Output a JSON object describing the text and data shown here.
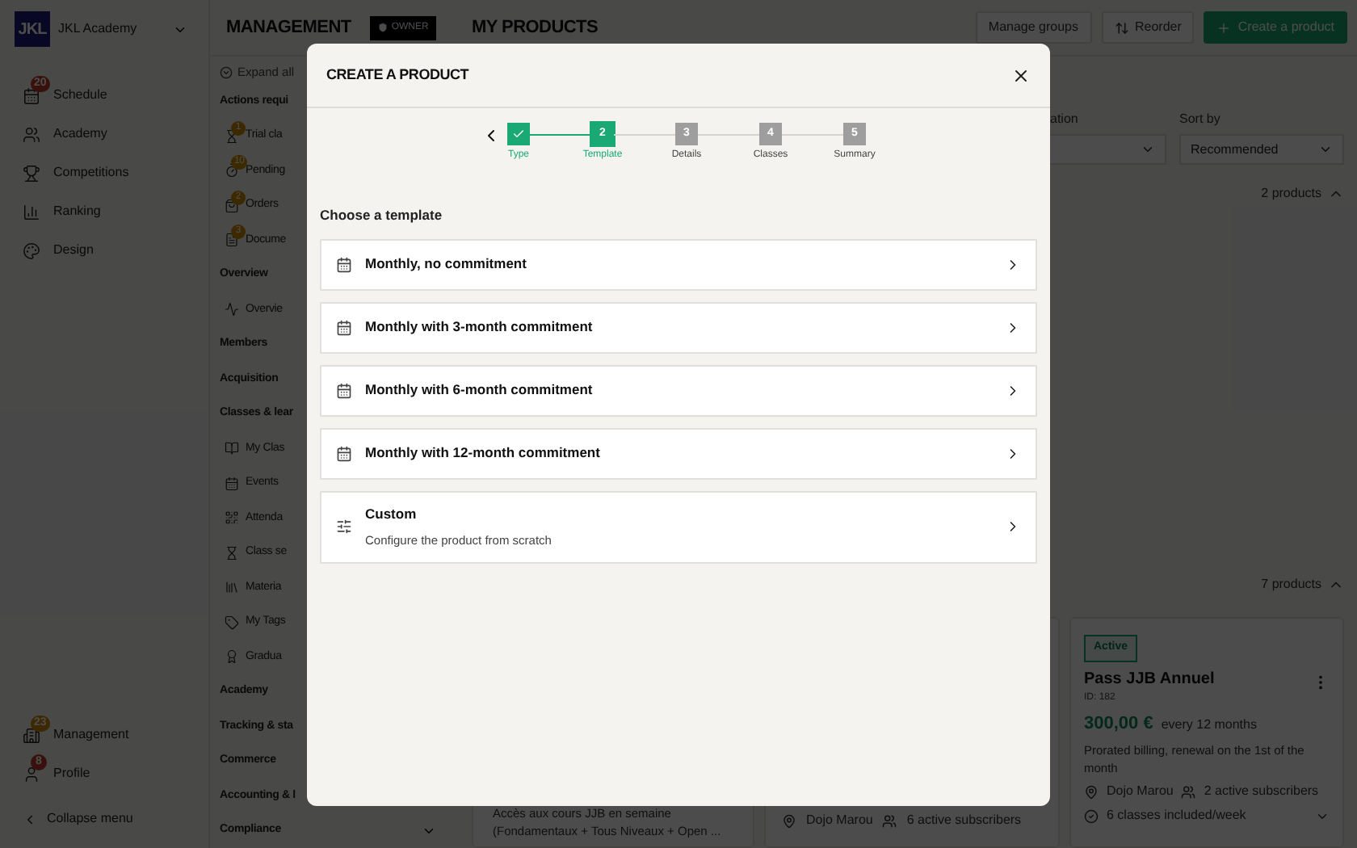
{
  "sidebar": {
    "academy_name": "JKL Academy",
    "logo_text": "JKL",
    "items": [
      {
        "label": "Schedule",
        "kind": "calendar",
        "badge": {
          "count": "20",
          "kind": "alert"
        }
      },
      {
        "label": "Academy",
        "kind": "users"
      },
      {
        "label": "Competitions",
        "kind": "trophy"
      },
      {
        "label": "Ranking",
        "kind": "ranking"
      },
      {
        "label": "Design",
        "kind": "palette"
      }
    ],
    "bottom_items": [
      {
        "label": "Management",
        "kind": "building",
        "badge": {
          "count": "23",
          "kind": "warning"
        }
      },
      {
        "label": "Profile",
        "kind": "user",
        "badge": {
          "count": "8",
          "kind": "alert"
        }
      }
    ],
    "collapse": "Collapse menu"
  },
  "header": {
    "section_title": "MANAGEMENT",
    "role_badge": "OWNER",
    "page_title": "MY PRODUCTS",
    "buttons": [
      {
        "label": "Manage groups",
        "kind": "plain"
      },
      {
        "label": "Reorder",
        "kind": "reorder"
      },
      {
        "label": "Create a product",
        "kind": "primary"
      }
    ]
  },
  "management_nav": {
    "expand_all": "Expand all",
    "sections": [
      {
        "label": "Actions requi",
        "children": [
          {
            "label": "Trial cla",
            "kind": "hourglass",
            "badge": "1"
          },
          {
            "label": "Pending",
            "kind": "timer",
            "badge": "10"
          },
          {
            "label": "Orders",
            "kind": "bag",
            "badge": "2"
          },
          {
            "label": "Docume",
            "kind": "document",
            "badge": "3"
          }
        ]
      },
      {
        "label": "Overview",
        "children": [
          {
            "label": "Overvie",
            "kind": "pulse"
          }
        ]
      },
      {
        "label": "Members"
      },
      {
        "label": "Acquisition"
      },
      {
        "label": "Classes & lear",
        "children": [
          {
            "label": "My Clas",
            "kind": "book"
          },
          {
            "label": "Events",
            "kind": "calendar"
          },
          {
            "label": "Attenda",
            "kind": "qr"
          },
          {
            "label": "Class se",
            "kind": "hourglass"
          },
          {
            "label": "Materia",
            "kind": "library"
          },
          {
            "label": "My Tags",
            "kind": "tag"
          },
          {
            "label": "Gradua",
            "kind": "award"
          }
        ]
      },
      {
        "label": "Academy"
      },
      {
        "label": "Tracking & sta"
      },
      {
        "label": "Commerce"
      },
      {
        "label": "Accounting & l"
      },
      {
        "label": "Compliance",
        "expanded": false
      }
    ]
  },
  "filters": [
    {
      "label": "ation"
    },
    {
      "label": "Sort by",
      "value": "Recommended"
    }
  ],
  "groups": [
    {
      "count": "2 products",
      "expanded": true
    },
    {
      "count": "7 products",
      "expanded": true
    }
  ],
  "cards": [
    {
      "kind": "text",
      "description": "Accès aux cours JJB en semaine (Fondamentaux + Tous Niveaux + Open ..."
    },
    {
      "kind": "meta",
      "location": "Dojo Marou",
      "subscribers": "6 active subscribers"
    },
    {
      "kind": "full",
      "status": "Active",
      "name": "Pass JJB Annuel",
      "id": "ID: 182",
      "price": "300,00 €",
      "period": "every 12 months",
      "billing": "Prorated billing, renewal on the 1st of the month",
      "location": "Dojo Marou",
      "subscribers": "2 active subscribers",
      "classes": "6 classes included/week"
    }
  ],
  "dialog": {
    "title": "CREATE A PRODUCT",
    "steps": [
      {
        "label": "Type",
        "completed": true,
        "selected": false
      },
      {
        "number": "2",
        "label": "Template",
        "completed": false,
        "selected": true
      },
      {
        "number": "3",
        "label": "Details",
        "completed": false,
        "selected": false
      },
      {
        "number": "4",
        "label": "Classes",
        "completed": false,
        "selected": false
      },
      {
        "number": "5",
        "label": "Summary",
        "completed": false,
        "selected": false
      }
    ],
    "heading": "Choose a template",
    "templates": [
      {
        "kind": "preset",
        "title": "Monthly, no commitment"
      },
      {
        "kind": "preset",
        "title": "Monthly with 3-month commitment"
      },
      {
        "kind": "preset",
        "title": "Monthly with 6-month commitment"
      },
      {
        "kind": "preset",
        "title": "Monthly with 12-month commitment"
      },
      {
        "kind": "custom",
        "title": "Custom",
        "description": "Configure the product from scratch"
      }
    ]
  }
}
